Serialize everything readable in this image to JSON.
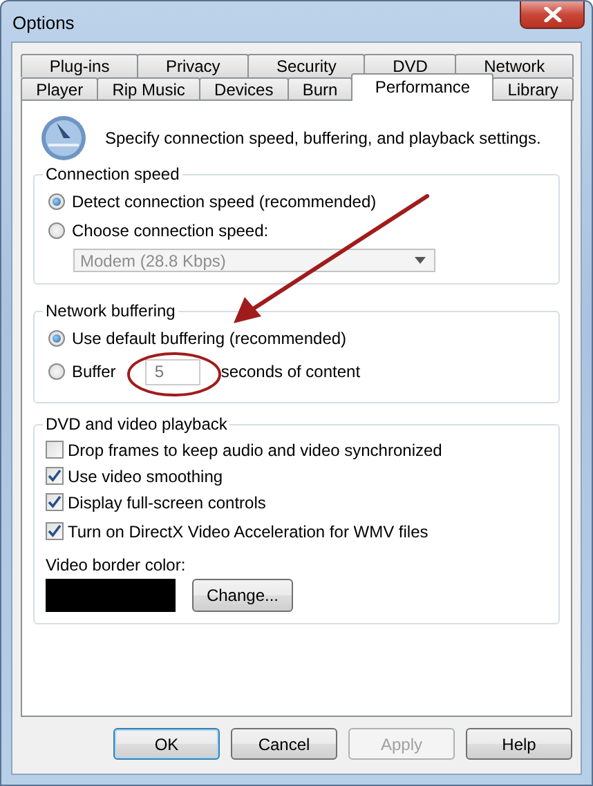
{
  "window": {
    "title": "Options"
  },
  "tabs": {
    "back_row": [
      {
        "label": "Plug-ins",
        "selected": false
      },
      {
        "label": "Privacy",
        "selected": false
      },
      {
        "label": "Security",
        "selected": false
      },
      {
        "label": "DVD",
        "selected": false
      },
      {
        "label": "Network",
        "selected": false
      }
    ],
    "front_row": [
      {
        "label": "Player",
        "selected": false
      },
      {
        "label": "Rip Music",
        "selected": false
      },
      {
        "label": "Devices",
        "selected": false
      },
      {
        "label": "Burn",
        "selected": false
      },
      {
        "label": "Performance",
        "selected": true
      },
      {
        "label": "Library",
        "selected": false
      }
    ]
  },
  "description": "Specify connection speed, buffering, and playback settings.",
  "connection_speed": {
    "title": "Connection speed",
    "options": [
      {
        "label": "Detect connection speed (recommended)",
        "selected": true
      },
      {
        "label": "Choose connection speed:",
        "selected": false
      }
    ],
    "dropdown": {
      "value": "Modem (28.8 Kbps)",
      "disabled": true
    }
  },
  "network_buffering": {
    "title": "Network buffering",
    "options": [
      {
        "kind": "plain",
        "label": "Use default buffering (recommended)",
        "selected": true
      },
      {
        "kind": "field",
        "label": "Buffer",
        "value": "5",
        "suffix": "seconds of content",
        "selected": false
      }
    ]
  },
  "playback": {
    "title": "DVD and video playback",
    "checkboxes": [
      {
        "label": "Drop frames to keep audio and video synchronized",
        "checked": false
      },
      {
        "label": "Use video smoothing",
        "checked": true
      },
      {
        "label": "Display full-screen controls",
        "checked": true
      },
      {
        "label": "Turn on DirectX Video Acceleration for WMV files",
        "checked": true
      }
    ],
    "border_color_label": "Video border color:",
    "change_button": "Change..."
  },
  "buttons": [
    {
      "label": "OK",
      "disabled": false,
      "default": true
    },
    {
      "label": "Cancel",
      "disabled": false,
      "default": false
    },
    {
      "label": "Apply",
      "disabled": true,
      "default": false
    },
    {
      "label": "Help",
      "disabled": false,
      "default": false
    }
  ]
}
